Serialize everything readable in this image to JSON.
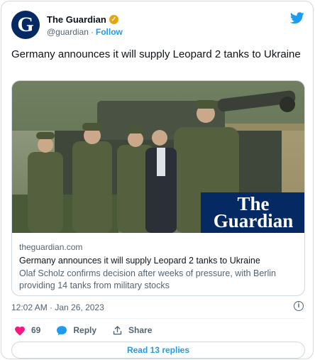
{
  "account": {
    "avatar_letter": "G",
    "name": "The Guardian",
    "verified_icon": "verified-badge-icon",
    "handle": "@guardian",
    "separator": "·",
    "follow_label": "Follow",
    "brand_icon": "twitter-bird-icon"
  },
  "tweet": {
    "text": "Germany announces it will supply Leopard 2 tanks to Ukraine"
  },
  "link_card": {
    "image_icon": "tank-soldiers-photo",
    "brand_line1": "The",
    "brand_line2": "Guardian",
    "domain": "theguardian.com",
    "title": "Germany announces it will supply Leopard 2 tanks to Ukraine",
    "description": "Olaf Scholz confirms decision after weeks of pressure, with Berlin providing 14 tanks from military stocks"
  },
  "meta": {
    "timestamp": "12:02 AM · Jan 26, 2023",
    "info_icon": "info-icon"
  },
  "actions": {
    "like_count": "69",
    "reply_label": "Reply",
    "share_label": "Share"
  },
  "replies_button": "Read 13 replies",
  "colors": {
    "accent": "#1d9bf0",
    "guardian_blue": "#052962",
    "like": "#f91880",
    "muted": "#536471",
    "border": "#cfd9de"
  }
}
